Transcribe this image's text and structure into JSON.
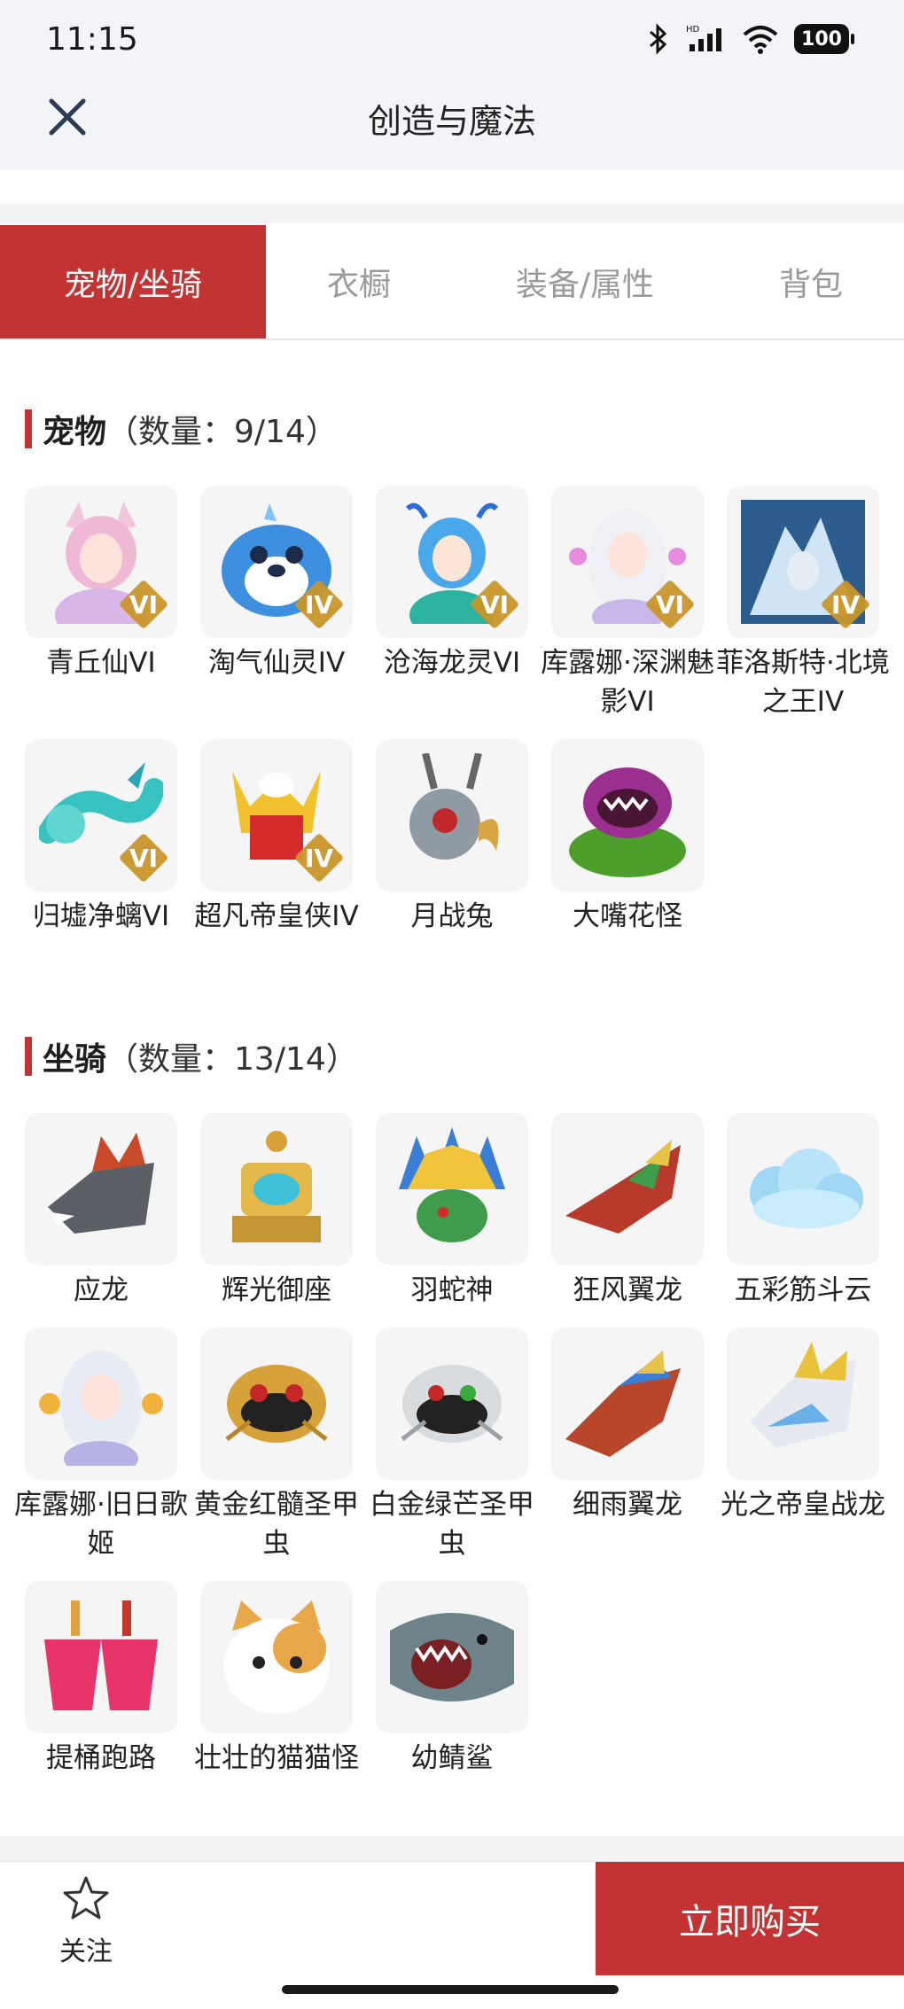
{
  "status_bar": {
    "time": "11:15",
    "network": "HD",
    "battery": "100"
  },
  "header": {
    "title": "创造与魔法"
  },
  "tabs": [
    {
      "label": "宠物/坐骑",
      "active": true
    },
    {
      "label": "衣橱",
      "active": false
    },
    {
      "label": "装备/属性",
      "active": false
    },
    {
      "label": "背包",
      "active": false
    }
  ],
  "pets": {
    "title": "宠物",
    "count": "（数量：9/14）",
    "items": [
      {
        "name": "青丘仙VI",
        "badge": "VI",
        "icon": "fox-fairy"
      },
      {
        "name": "淘气仙灵IV",
        "badge": "IV",
        "icon": "blue-seal"
      },
      {
        "name": "沧海龙灵VI",
        "badge": "VI",
        "icon": "sea-dragon-spirit"
      },
      {
        "name": "库露娜·深渊魅影VI",
        "badge": "VI",
        "icon": "white-haired-maiden"
      },
      {
        "name": "菲洛斯特·北境之王IV",
        "badge": "IV",
        "icon": "ice-king"
      },
      {
        "name": "归墟净螭VI",
        "badge": "VI",
        "icon": "cyan-dragon"
      },
      {
        "name": "超凡帝皇侠IV",
        "badge": "IV",
        "icon": "golden-emperor"
      },
      {
        "name": "月战兔",
        "badge": "",
        "icon": "robot-rabbit"
      },
      {
        "name": "大嘴花怪",
        "badge": "",
        "icon": "piranha-plant"
      }
    ]
  },
  "mounts": {
    "title": "坐骑",
    "count": "（数量：13/14）",
    "items": [
      {
        "name": "应龙",
        "icon": "grey-dragon"
      },
      {
        "name": "辉光御座",
        "icon": "golden-throne"
      },
      {
        "name": "羽蛇神",
        "icon": "feathered-serpent"
      },
      {
        "name": "狂风翼龙",
        "icon": "wind-wyvern"
      },
      {
        "name": "五彩筋斗云",
        "icon": "cloud"
      },
      {
        "name": "库露娜·旧日歌姬",
        "icon": "singer-maiden"
      },
      {
        "name": "黄金红髓圣甲虫",
        "icon": "golden-scarab"
      },
      {
        "name": "白金绿芒圣甲虫",
        "icon": "platinum-scarab"
      },
      {
        "name": "细雨翼龙",
        "icon": "rain-wyvern"
      },
      {
        "name": "光之帝皇战龙",
        "icon": "light-war-dragon"
      },
      {
        "name": "提桶跑路",
        "icon": "bucket"
      },
      {
        "name": "壮壮的猫猫怪",
        "icon": "cat-monster"
      },
      {
        "name": "幼鲭鲨",
        "icon": "shark"
      }
    ]
  },
  "bottom_bar": {
    "follow_label": "关注",
    "buy_label": "立即购买"
  },
  "colors": {
    "accent": "#c33333",
    "badge_gold": "#c9962a",
    "tile_bg": "#f5f5f5"
  }
}
